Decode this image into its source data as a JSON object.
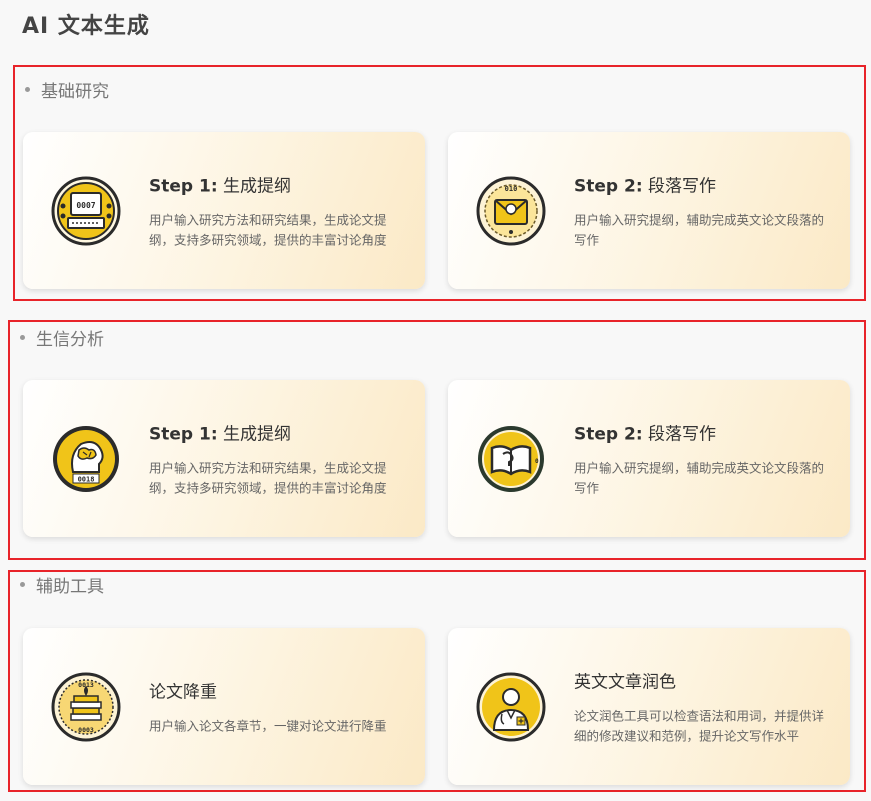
{
  "page": {
    "title": "AI 文本生成"
  },
  "sections": [
    {
      "label": "基础研究",
      "cards": [
        {
          "title": "Step 1: 生成提纲",
          "description": "用户输入研究方法和研究结果，生成论文提纲，支持多研究领域，提供的丰富讨论角度",
          "icon": "computer-icon",
          "icon_text": "0007"
        },
        {
          "title": "Step 2: 段落写作",
          "description": "用户输入研究提纲，辅助完成英文论文段落的写作",
          "icon": "envelope-icon",
          "icon_text": "010"
        }
      ]
    },
    {
      "label": "生信分析",
      "cards": [
        {
          "title": "Step 1: 生成提纲",
          "description": "用户输入研究方法和研究结果，生成论文提纲，支持多研究领域，提供的丰富讨论角度",
          "icon": "brain-head-icon",
          "icon_text": "0018"
        },
        {
          "title": "Step 2: 段落写作",
          "description": "用户输入研究提纲，辅助完成英文论文段落的写作",
          "icon": "open-book-icon",
          "icon_text": "0"
        }
      ]
    },
    {
      "label": "辅助工具",
      "cards": [
        {
          "title": "论文降重",
          "description": "用户输入论文各章节，一键对论文进行降重",
          "icon": "stacked-books-icon",
          "icon_text_top": "0013",
          "icon_text_bottom": "0003"
        },
        {
          "title": "英文文章润色",
          "description": "论文润色工具可以检查语法和用词，并提供详细的修改建议和范例，提升论文写作水平",
          "icon": "doctor-icon"
        }
      ]
    }
  ],
  "colors": {
    "accent_gold": "#f0c419",
    "icon_dark": "#2b2b2b",
    "section_border": "#e8242a"
  }
}
